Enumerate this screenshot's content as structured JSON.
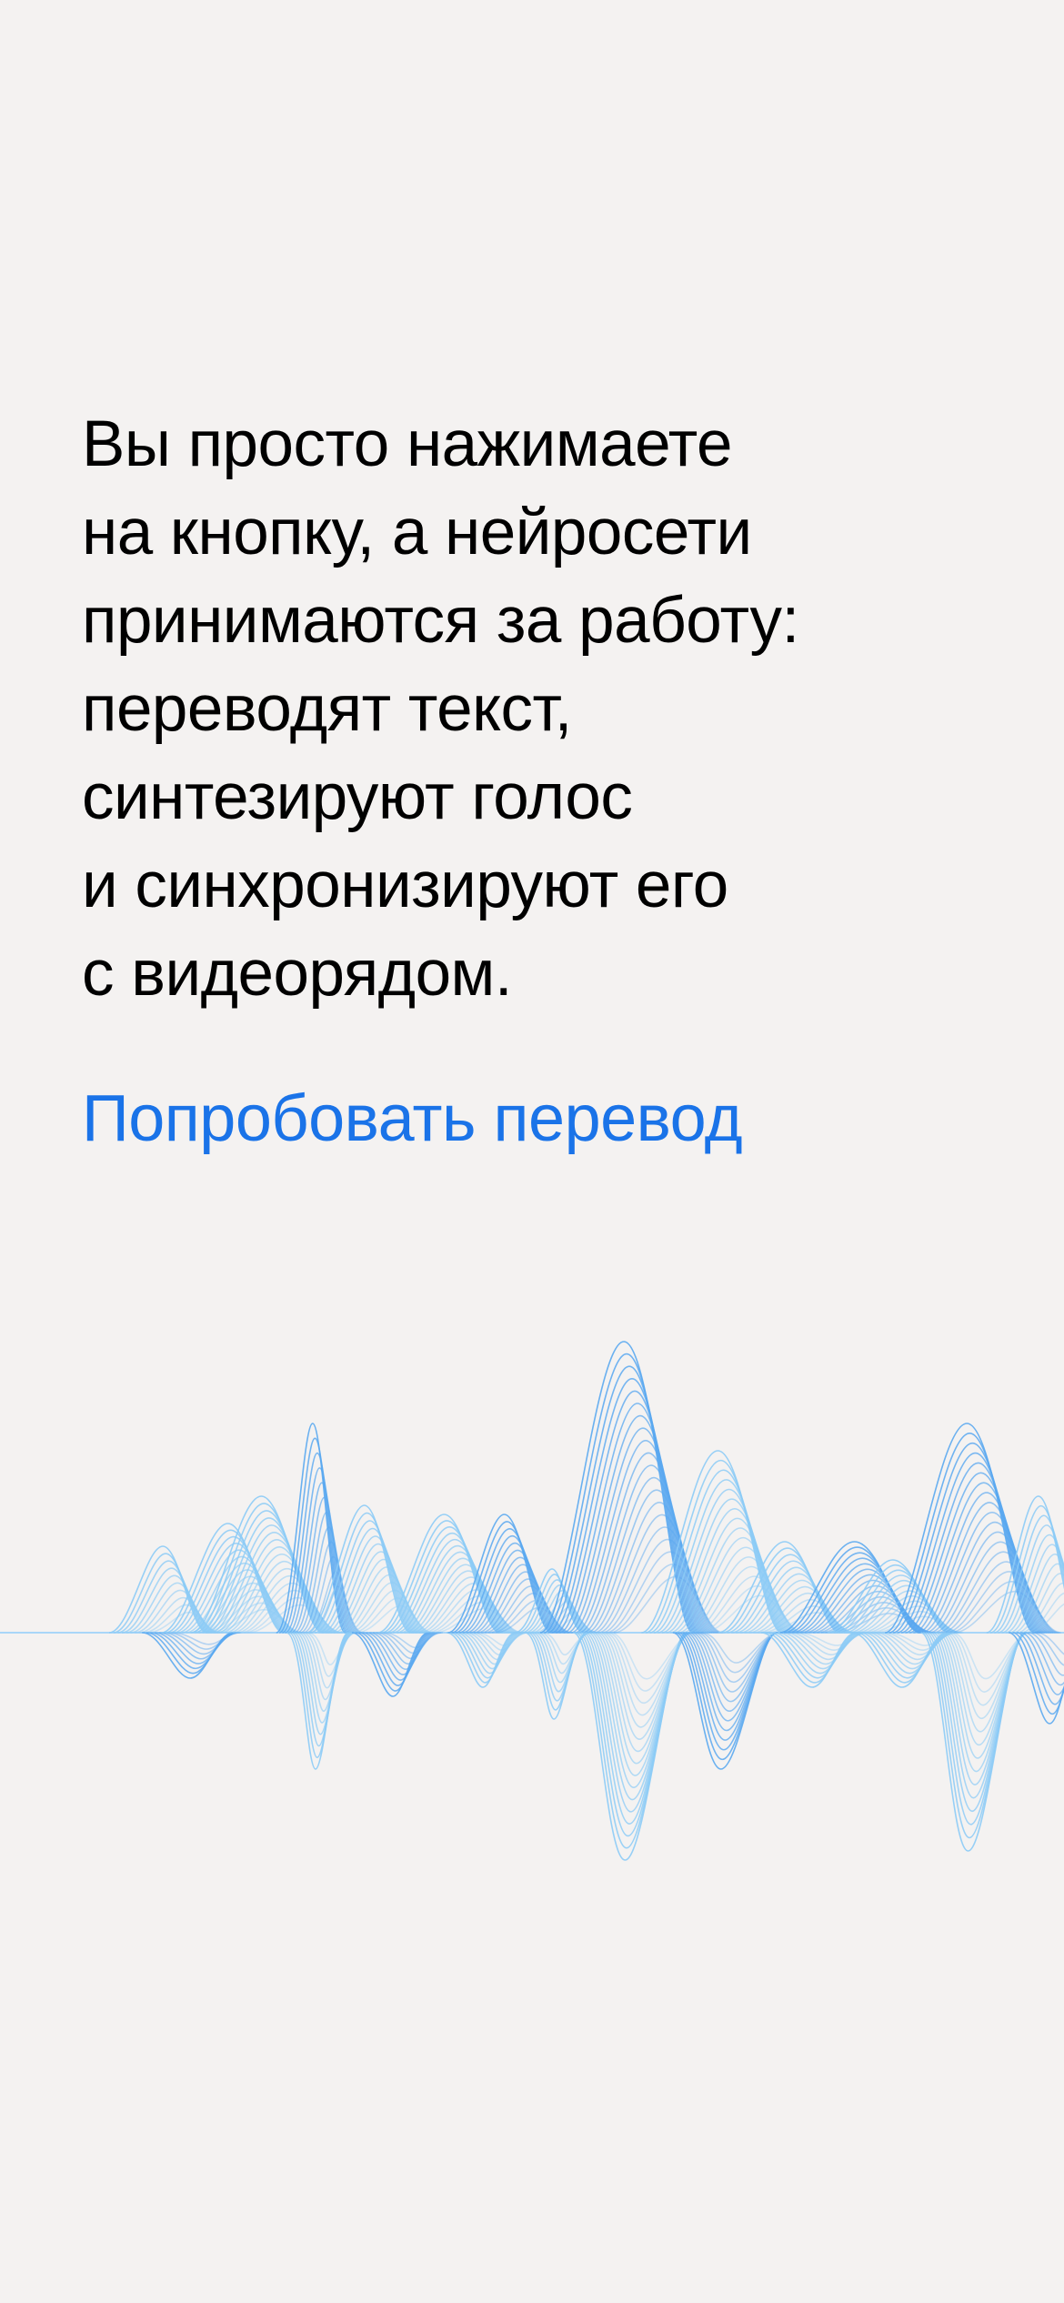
{
  "intro": {
    "lines": [
      "Вы просто нажимаете",
      "на кнопку, а нейросети",
      "принимаются за работу:",
      "переводят текст,",
      "синтезируют голос",
      "и синхронизируют его",
      "с видеорядом."
    ]
  },
  "cta": {
    "label": "Попробовать перевод"
  },
  "colors": {
    "background": "#f4f2f1",
    "text": "#000000",
    "accent": "#1a73e8",
    "wave_light": "#8ccbf6",
    "wave_dark": "#5aa8f0"
  },
  "decoration": {
    "icon": "sound-wave-illustration"
  }
}
